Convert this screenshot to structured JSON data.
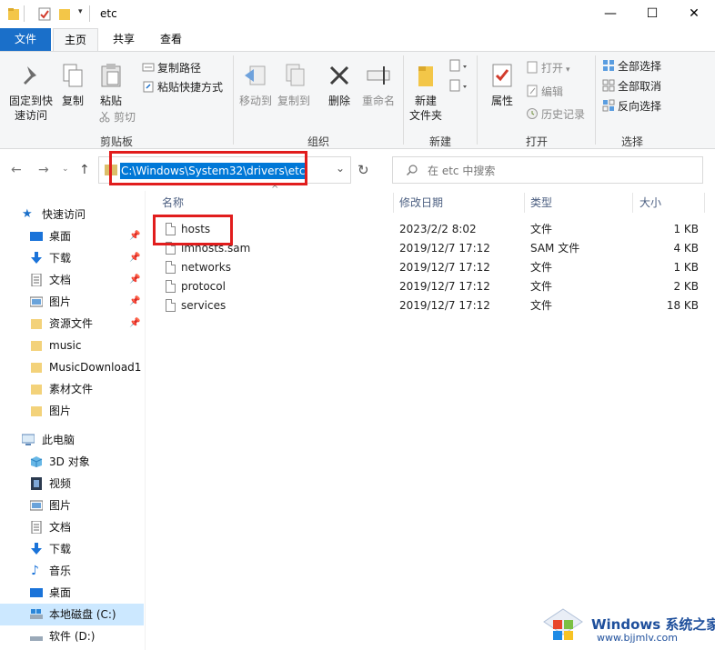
{
  "titlebar": {
    "title": "etc",
    "minimize": "—",
    "maximize": "☐",
    "close": "✕"
  },
  "ribbon_tabs": {
    "file": "文件",
    "home": "主页",
    "share": "共享",
    "view": "查看",
    "help": "?"
  },
  "ribbon": {
    "clipboard": {
      "pin_quick_access_1": "固定到快",
      "pin_quick_access_2": "速访问",
      "copy": "复制",
      "paste": "粘贴",
      "copy_path": "复制路径",
      "paste_shortcut": "粘贴快捷方式",
      "cut": "剪切",
      "group": "剪贴板"
    },
    "organize": {
      "move_to": "移动到",
      "copy_to": "复制到",
      "delete": "删除",
      "rename": "重命名",
      "group": "组织"
    },
    "new": {
      "new_folder_1": "新建",
      "new_folder_2": "文件夹",
      "group": "新建"
    },
    "open": {
      "properties": "属性",
      "open": "打开",
      "edit": "编辑",
      "history": "历史记录",
      "group": "打开"
    },
    "select": {
      "select_all": "全部选择",
      "select_none": "全部取消",
      "invert": "反向选择",
      "group": "选择"
    }
  },
  "addressbar": {
    "path": "C:\\Windows\\System32\\drivers\\etc",
    "search_placeholder": "在 etc 中搜索"
  },
  "navpane": {
    "quick_access": "快速访问",
    "items": [
      {
        "label": "桌面",
        "pinned": true
      },
      {
        "label": "下载",
        "pinned": true
      },
      {
        "label": "文档",
        "pinned": true
      },
      {
        "label": "图片",
        "pinned": true
      },
      {
        "label": "资源文件",
        "pinned": true
      },
      {
        "label": "music",
        "pinned": false
      },
      {
        "label": "MusicDownload1",
        "pinned": false
      },
      {
        "label": "素材文件",
        "pinned": false
      },
      {
        "label": "图片",
        "pinned": false
      }
    ],
    "this_pc": "此电脑",
    "pc_items": [
      {
        "label": "3D 对象"
      },
      {
        "label": "视频"
      },
      {
        "label": "图片"
      },
      {
        "label": "文档"
      },
      {
        "label": "下载"
      },
      {
        "label": "音乐"
      },
      {
        "label": "桌面"
      },
      {
        "label": "本地磁盘 (C:)"
      },
      {
        "label": "软件 (D:)"
      }
    ]
  },
  "filelist": {
    "columns": {
      "name": "名称",
      "modified": "修改日期",
      "type": "类型",
      "size": "大小"
    },
    "rows": [
      {
        "name": "hosts",
        "modified": "2023/2/2 8:02",
        "type": "文件",
        "size": "1 KB"
      },
      {
        "name": "lmhosts.sam",
        "modified": "2019/12/7 17:12",
        "type": "SAM 文件",
        "size": "4 KB"
      },
      {
        "name": "networks",
        "modified": "2019/12/7 17:12",
        "type": "文件",
        "size": "1 KB"
      },
      {
        "name": "protocol",
        "modified": "2019/12/7 17:12",
        "type": "文件",
        "size": "2 KB"
      },
      {
        "name": "services",
        "modified": "2019/12/7 17:12",
        "type": "文件",
        "size": "18 KB"
      }
    ]
  },
  "watermark": {
    "title": "Windows 系统之家",
    "url": "www.bjjmlv.com"
  },
  "colors": {
    "accent": "#1a6fc9",
    "selection": "#0078d7",
    "highlight_box": "#e11d1d",
    "nav_selected": "#cce8ff"
  }
}
